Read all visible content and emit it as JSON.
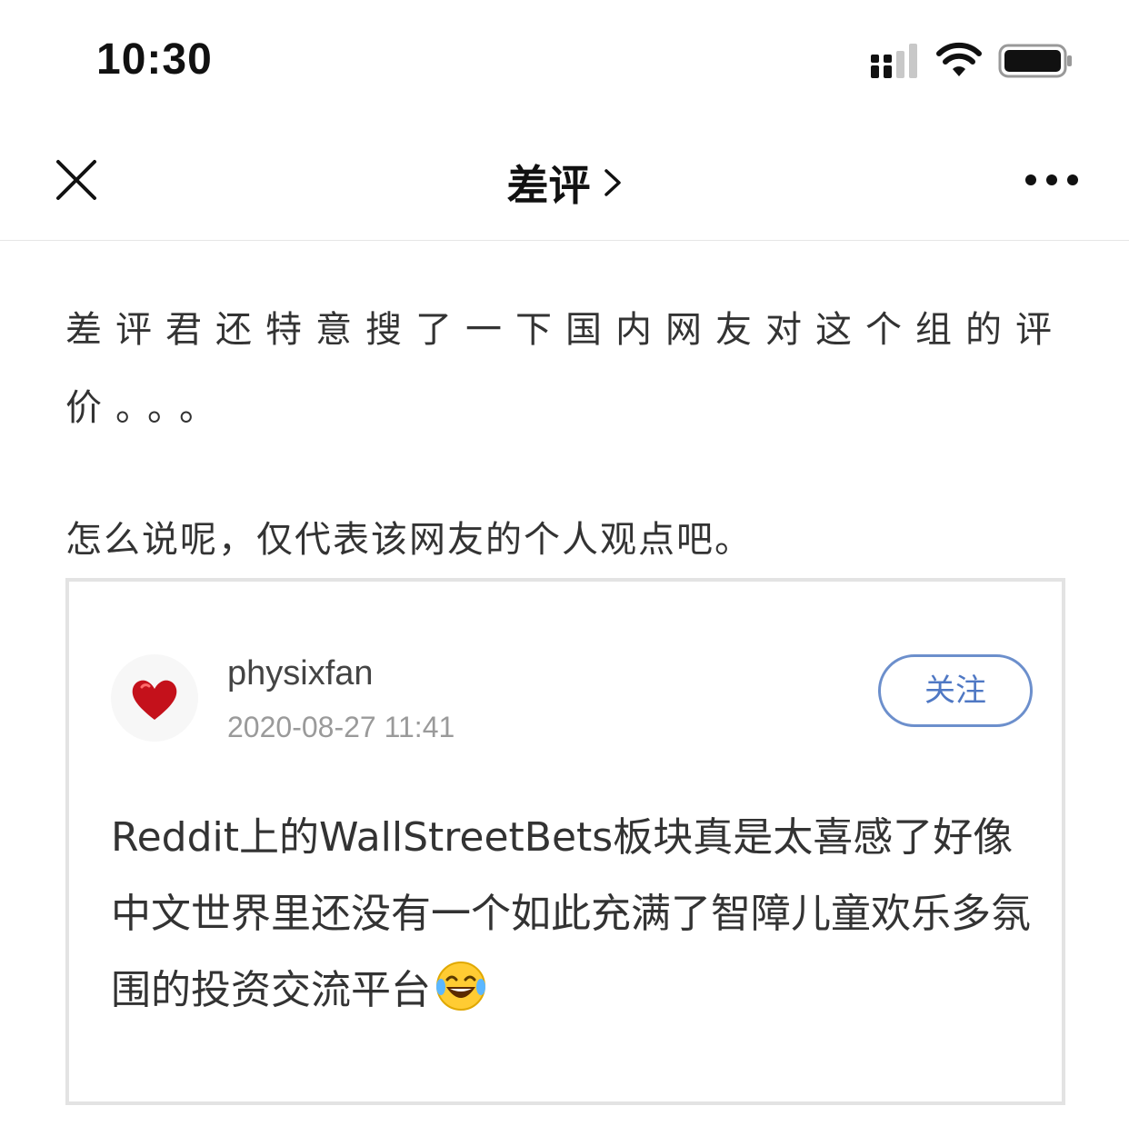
{
  "status_bar": {
    "time": "10:30"
  },
  "nav": {
    "title": "差评",
    "close_icon": "close-icon",
    "more_icon": "more-horizontal-icon"
  },
  "article": {
    "paragraph_1": "差评君还特意搜了一下国内网友对这个组的评价。。。",
    "paragraph_2": "怎么说呢，仅代表该网友的个人观点吧。"
  },
  "embedded_post": {
    "username": "physixfan",
    "timestamp": "2020-08-27 11:41",
    "follow_label": "关注",
    "body_text": "Reddit上的WallStreetBets板块真是太喜感了好像中文世界里还没有一个如此充满了智障儿童欢乐多氛围的投资交流平台",
    "emoji": "laughing-tears-emoji",
    "colors": {
      "follow_border": "#6c8fcc",
      "follow_text": "#4f78c4",
      "avatar_heart": "#c4111b"
    }
  }
}
